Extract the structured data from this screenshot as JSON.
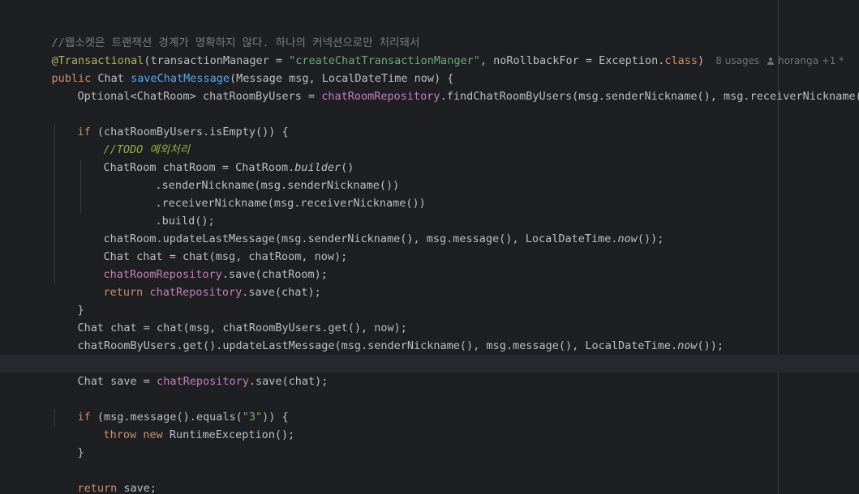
{
  "editor": {
    "comment_line": "//웹소켓은 트랜잭션 경계가 명확하지 않다. 하나의 커넥션으로만 처리돼서",
    "annotation": {
      "name": "@Transactional",
      "open": "(transactionManager = ",
      "manager_value": "\"createChatTransactionManger\"",
      "mid": ", noRollbackFor = Exception.",
      "class_kw": "class",
      "close": ")"
    },
    "inlay": {
      "usages": "8 usages",
      "author": "horanga +1 *"
    },
    "signature": {
      "modifier": "public",
      "return_type": " Chat ",
      "method_name": "saveChatMessage",
      "params": "(Message msg, LocalDateTime now) {"
    },
    "line_optional": {
      "prefix": "Optional<ChatRoom> chatRoomByUsers = ",
      "field": "chatRoomRepository",
      "suffix": ".findChatRoomByUsers(msg.senderNickname(), msg.receiverNickname());"
    },
    "line_if_empty": {
      "kw": "if",
      "rest": " (chatRoomByUsers.isEmpty()) {"
    },
    "todo_comment": "//TODO 예외처리",
    "line_builder": {
      "prefix": "ChatRoom chatRoom = ChatRoom.",
      "method": "builder",
      "suffix": "()"
    },
    "builder_sender": ".senderNickname(msg.senderNickname())",
    "builder_receiver": ".receiverNickname(msg.receiverNickname())",
    "builder_build": ".build();",
    "line_update1": {
      "prefix": "chatRoom.updateLastMessage(msg.senderNickname(), msg.message(), LocalDateTime.",
      "method": "now",
      "suffix": "());"
    },
    "line_chat_inner": "Chat chat = chat(msg, chatRoom, now);",
    "line_room_save": {
      "field": "chatRoomRepository",
      "suffix": ".save(chatRoom);"
    },
    "line_return_inner": {
      "kw": "return",
      "field": "chatRepository",
      "suffix": ".save(chat);"
    },
    "close_brace": "}",
    "line_chat_outer": "Chat chat = chat(msg, chatRoomByUsers.get(), now);",
    "line_update2": {
      "prefix": "chatRoomByUsers.get().updateLastMessage(msg.senderNickname(), msg.message(), LocalDateTime.",
      "method": "now",
      "suffix": "());"
    },
    "line_save": {
      "prefix": "Chat save = ",
      "field": "chatRepository",
      "suffix": ".save(chat);"
    },
    "line_if_three": {
      "kw": "if",
      "mid": " (msg.message().equals(",
      "str": "\"3\"",
      "suffix": ")) {"
    },
    "line_throw": {
      "kw_throw": "throw",
      "kw_new": "new",
      "suffix": " RuntimeException();"
    },
    "line_return_save": {
      "kw": "return",
      "suffix": " save;"
    }
  },
  "colors": {
    "background": "#1e1f22",
    "current_line": "#26282e",
    "keyword": "#cf8e6d",
    "annotation": "#b3ae60",
    "string": "#6aab73",
    "method_declaration": "#56a8f5",
    "field": "#c77dbb",
    "comment": "#7a7e85",
    "todo": "#8bb33d",
    "default_text": "#bcbec4"
  }
}
